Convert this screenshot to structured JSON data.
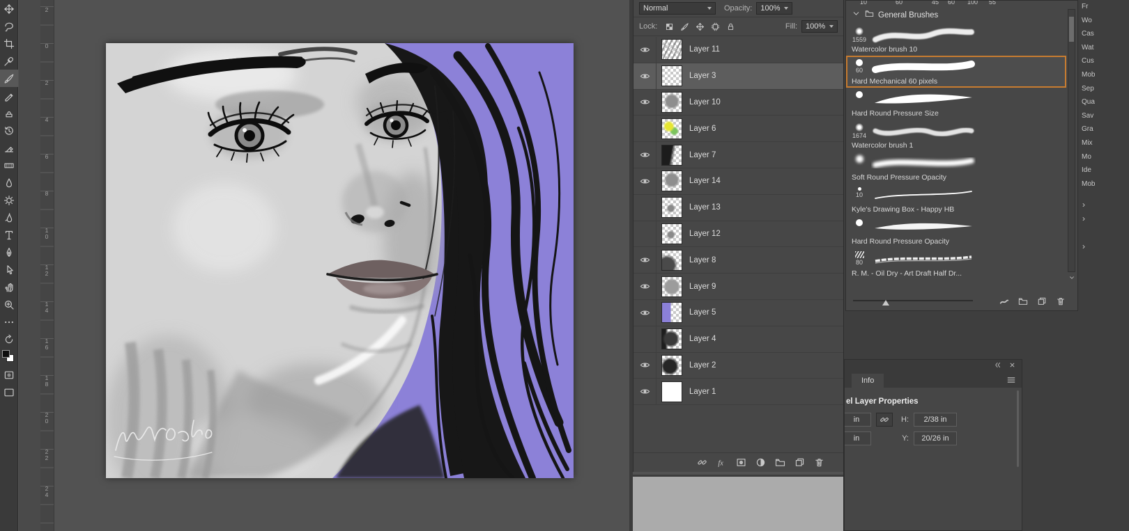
{
  "toolbar": {
    "tools": [
      {
        "id": "move-tool",
        "icon": "move",
        "selected": false
      },
      {
        "id": "lasso-tool",
        "icon": "lasso",
        "selected": false
      },
      {
        "id": "crop-tool",
        "icon": "crop",
        "selected": false
      },
      {
        "id": "eyedropper-tool",
        "icon": "eyedropper",
        "selected": false
      },
      {
        "id": "brush-tool",
        "icon": "brush",
        "selected": true
      },
      {
        "id": "pencil-tool",
        "icon": "pencil",
        "selected": false
      },
      {
        "id": "clone-stamp-tool",
        "icon": "clone",
        "selected": false
      },
      {
        "id": "history-brush-tool",
        "icon": "history",
        "selected": false
      },
      {
        "id": "eraser-tool",
        "icon": "eraser",
        "selected": false
      },
      {
        "id": "gradient-tool",
        "icon": "gradient",
        "selected": false
      },
      {
        "id": "blur-tool",
        "icon": "blur",
        "selected": false
      },
      {
        "id": "dodge-tool",
        "icon": "dodge",
        "selected": false
      },
      {
        "id": "smudge-tool",
        "icon": "smudge",
        "selected": false
      },
      {
        "id": "type-tool",
        "icon": "type",
        "selected": false
      },
      {
        "id": "pen-tool",
        "icon": "pen",
        "selected": false
      },
      {
        "id": "path-select-tool",
        "icon": "select",
        "selected": false
      },
      {
        "id": "hand-tool",
        "icon": "hand",
        "selected": false
      },
      {
        "id": "zoom-tool",
        "icon": "zoom",
        "selected": false
      },
      {
        "id": "more-tools",
        "icon": "dots",
        "selected": false
      },
      {
        "id": "rotate-view-tool",
        "icon": "rotate",
        "selected": false
      },
      {
        "id": "color-swatches",
        "icon": "swatches",
        "selected": false
      },
      {
        "id": "quick-mask-toggle",
        "icon": "quickmask",
        "selected": false
      },
      {
        "id": "screen-mode-toggle",
        "icon": "screen",
        "selected": false
      }
    ]
  },
  "ruler": {
    "labels": [
      "2",
      "0",
      "2",
      "4",
      "6",
      "8",
      "10",
      "12",
      "14",
      "16",
      "18",
      "20",
      "22",
      "24"
    ]
  },
  "layer_options": {
    "blend_mode": "Normal",
    "opacity_label": "Opacity:",
    "opacity_value": "100%",
    "lock_label": "Lock:",
    "fill_label": "Fill:",
    "fill_value": "100%"
  },
  "lock_options": [
    {
      "id": "lock-transparent-pixels",
      "icon": "checker"
    },
    {
      "id": "lock-image-pixels",
      "icon": "brush"
    },
    {
      "id": "lock-position",
      "icon": "move"
    },
    {
      "id": "lock-artboard",
      "icon": "frame"
    },
    {
      "id": "lock-all",
      "icon": "padlock"
    }
  ],
  "layers": [
    {
      "name": "Layer 11",
      "visible": true,
      "selected": false,
      "thumb": "strokes"
    },
    {
      "name": "Layer 3",
      "visible": true,
      "selected": true,
      "thumb": "empty"
    },
    {
      "name": "Layer 10",
      "visible": true,
      "selected": false,
      "thumb": "grayblob"
    },
    {
      "name": "Layer 6",
      "visible": false,
      "selected": false,
      "thumb": "yellow"
    },
    {
      "name": "Layer 7",
      "visible": true,
      "selected": false,
      "thumb": "dark"
    },
    {
      "name": "Layer 14",
      "visible": true,
      "selected": false,
      "thumb": "grayblob"
    },
    {
      "name": "Layer 13",
      "visible": false,
      "selected": false,
      "thumb": "graysmall"
    },
    {
      "name": "Layer 12",
      "visible": false,
      "selected": false,
      "thumb": "graysmall"
    },
    {
      "name": "Layer 8",
      "visible": true,
      "selected": false,
      "thumb": "darkcorner"
    },
    {
      "name": "Layer 9",
      "visible": true,
      "selected": false,
      "thumb": "graybig"
    },
    {
      "name": "Layer 5",
      "visible": true,
      "selected": false,
      "thumb": "purple"
    },
    {
      "name": "Layer 4",
      "visible": false,
      "selected": false,
      "thumb": "darkface"
    },
    {
      "name": "Layer 2",
      "visible": true,
      "selected": false,
      "thumb": "darkblob"
    },
    {
      "name": "Layer 1",
      "visible": true,
      "selected": false,
      "thumb": "white"
    }
  ],
  "layers_footer": [
    {
      "id": "link-layers",
      "icon": "link"
    },
    {
      "id": "layer-effects",
      "icon": "fx"
    },
    {
      "id": "add-layer-mask",
      "icon": "mask"
    },
    {
      "id": "new-adjustment-layer",
      "icon": "adjust"
    },
    {
      "id": "new-group",
      "icon": "folder"
    },
    {
      "id": "new-layer",
      "icon": "newlayer"
    },
    {
      "id": "delete-layer",
      "icon": "trash"
    }
  ],
  "brushes": {
    "panel_title": "General Brushes",
    "clipped_sizes": [
      "10",
      "60",
      "45",
      "60",
      "100",
      "55"
    ],
    "items": [
      {
        "size": "1559",
        "name": "Watercolor brush 10",
        "tip": "textured",
        "stroke": "watercolor",
        "selected": false
      },
      {
        "size": "60",
        "name": "Hard Mechanical 60 pixels",
        "tip": "hard",
        "stroke": "hard",
        "selected": true
      },
      {
        "size": "",
        "name": "Hard Round Pressure Size",
        "tip": "hard",
        "stroke": "taper",
        "selected": false
      },
      {
        "size": "1674",
        "name": "Watercolor brush 1",
        "tip": "textured",
        "stroke": "watercolor2",
        "selected": false
      },
      {
        "size": "",
        "name": "Soft Round Pressure Opacity",
        "tip": "soft",
        "stroke": "soft",
        "selected": false
      },
      {
        "size": "10",
        "name": "Kyle's Drawing Box - Happy HB",
        "tip": "tiny",
        "stroke": "pencil",
        "selected": false
      },
      {
        "size": "",
        "name": "Hard Round Pressure Opacity",
        "tip": "hard",
        "stroke": "fadeout",
        "selected": false
      },
      {
        "size": "80",
        "name": "R. M. - Oil Dry - Art Draft Half Dr...",
        "tip": "scratchy",
        "stroke": "dry",
        "selected": false
      }
    ],
    "footer": [
      {
        "id": "brush-stroke-preview-toggle",
        "icon": "strokeicon"
      },
      {
        "id": "new-brush-group",
        "icon": "folder"
      },
      {
        "id": "new-brush",
        "icon": "newlayer"
      },
      {
        "id": "delete-brush",
        "icon": "trash"
      }
    ]
  },
  "right_dock": {
    "labels": [
      "Fr",
      "Wo",
      "Cas",
      "Wat",
      "Cus",
      "Mob",
      "Sep",
      "Qua",
      "Sav",
      "Gra",
      "Mix",
      "Mo",
      "Ide",
      "Mob"
    ],
    "chevron_positions": [
      288,
      308,
      348
    ]
  },
  "info_panel": {
    "tab": "Info",
    "properties_title": "el Layer Properties",
    "row1": {
      "unit": "in",
      "label": "H:",
      "value": "2/38 in"
    },
    "row2": {
      "unit": "in",
      "label": "Y:",
      "value": "20/26 in"
    }
  },
  "colors": {
    "brush_selection_border": "#c87c30",
    "canvas_background_purple": "#8c81d8",
    "panel_background": "#474747"
  }
}
